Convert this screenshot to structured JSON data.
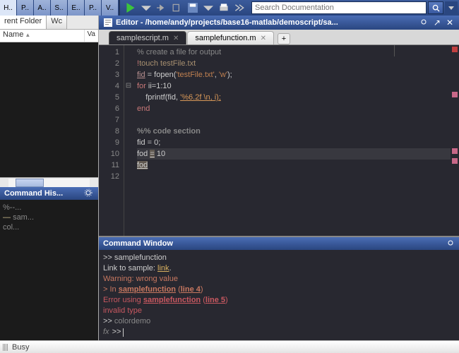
{
  "ribbon": {
    "tabs": [
      "H..",
      "P..",
      "A..",
      "S..",
      "E..",
      "P..",
      "V.."
    ],
    "active": 0
  },
  "search": {
    "placeholder": "Search Documentation"
  },
  "folder": {
    "tabs": [
      {
        "label": "rent Folder"
      },
      {
        "label": "Wc"
      }
    ],
    "cols": {
      "name": "Name",
      "sort": "▲",
      "val": "Va"
    }
  },
  "cmdhist": {
    "title": "Command His...",
    "items": [
      "%--...",
      "sam...",
      "col..."
    ]
  },
  "editor": {
    "title_prefix": "Editor - ",
    "path": "/home/andy/projects/base16-matlab/demoscript/sa...",
    "tabs": [
      {
        "label": "samplescript.m"
      },
      {
        "label": "samplefunction.m"
      }
    ],
    "active_tab": 0,
    "lines": [
      {
        "n": "1",
        "segs": [
          {
            "t": "% create a file for output",
            "c": "c-comment"
          }
        ]
      },
      {
        "n": "2",
        "segs": [
          {
            "t": "!",
            "c": "c-key"
          },
          {
            "t": "touch testFile.txt",
            "c": "c-cmd"
          }
        ]
      },
      {
        "n": "3",
        "segs": [
          {
            "t": "fid",
            "c": "c-var"
          },
          {
            "t": " = fopen(",
            "c": "c-op"
          },
          {
            "t": "'testFile.txt'",
            "c": "c-str"
          },
          {
            "t": ", ",
            "c": "c-op"
          },
          {
            "t": "'w'",
            "c": "c-str"
          },
          {
            "t": ");",
            "c": "c-op"
          }
        ]
      },
      {
        "n": "4",
        "segs": [
          {
            "t": "for ",
            "c": "c-key"
          },
          {
            "t": "ii=1:10",
            "c": "c-op"
          }
        ],
        "fold": "⊟"
      },
      {
        "n": "5",
        "segs": [
          {
            "t": "    fprintf(fid, ",
            "c": "c-op"
          },
          {
            "t": "'%6.2f \\n, i);",
            "c": "c-err"
          }
        ]
      },
      {
        "n": "6",
        "segs": [
          {
            "t": "end",
            "c": "c-key"
          }
        ]
      },
      {
        "n": "7",
        "segs": []
      },
      {
        "n": "8",
        "segs": [
          {
            "t": "%% code section",
            "c": "c-sec"
          }
        ]
      },
      {
        "n": "9",
        "segs": [
          {
            "t": "fid = 0;",
            "c": "c-op"
          }
        ]
      },
      {
        "n": "10",
        "segs": [
          {
            "t": "fod ",
            "c": "c-op"
          },
          {
            "t": "=",
            "c": "c-hilite"
          },
          {
            "t": " 10",
            "c": "c-op"
          }
        ],
        "cur": true
      },
      {
        "n": "11",
        "segs": [
          {
            "t": "fod",
            "c": "c-hilite"
          }
        ]
      },
      {
        "n": "12",
        "segs": []
      }
    ]
  },
  "cmdwin": {
    "title": "Command Window",
    "lines": [
      [
        {
          "t": ">> samplefunction",
          "c": ""
        }
      ],
      [
        {
          "t": "Link to sample: ",
          "c": ""
        },
        {
          "t": "link",
          "c": "cw-link"
        },
        {
          "t": ".",
          "c": ""
        }
      ],
      [
        {
          "t": "Warning: wrong value",
          "c": "cw-warn"
        }
      ],
      [
        {
          "t": "> In ",
          "c": "cw-warn"
        },
        {
          "t": "samplefunction",
          "c": "cw-warn cw-fn"
        },
        {
          "t": " (",
          "c": "cw-warn"
        },
        {
          "t": "line 4",
          "c": "cw-warn cw-fn"
        },
        {
          "t": ")",
          "c": "cw-warn"
        }
      ],
      [
        {
          "t": "Error using ",
          "c": "cw-err"
        },
        {
          "t": "samplefunction",
          "c": "cw-err cw-fn"
        },
        {
          "t": " (",
          "c": "cw-err"
        },
        {
          "t": "line 5",
          "c": "cw-err cw-fn"
        },
        {
          "t": ")",
          "c": "cw-err"
        }
      ],
      [
        {
          "t": "invalid type",
          "c": "cw-err"
        }
      ],
      [
        {
          "t": ">> ",
          "c": ""
        },
        {
          "t": "colordemo",
          "c": "cw-inp"
        }
      ]
    ]
  },
  "status": {
    "text": "Busy"
  }
}
